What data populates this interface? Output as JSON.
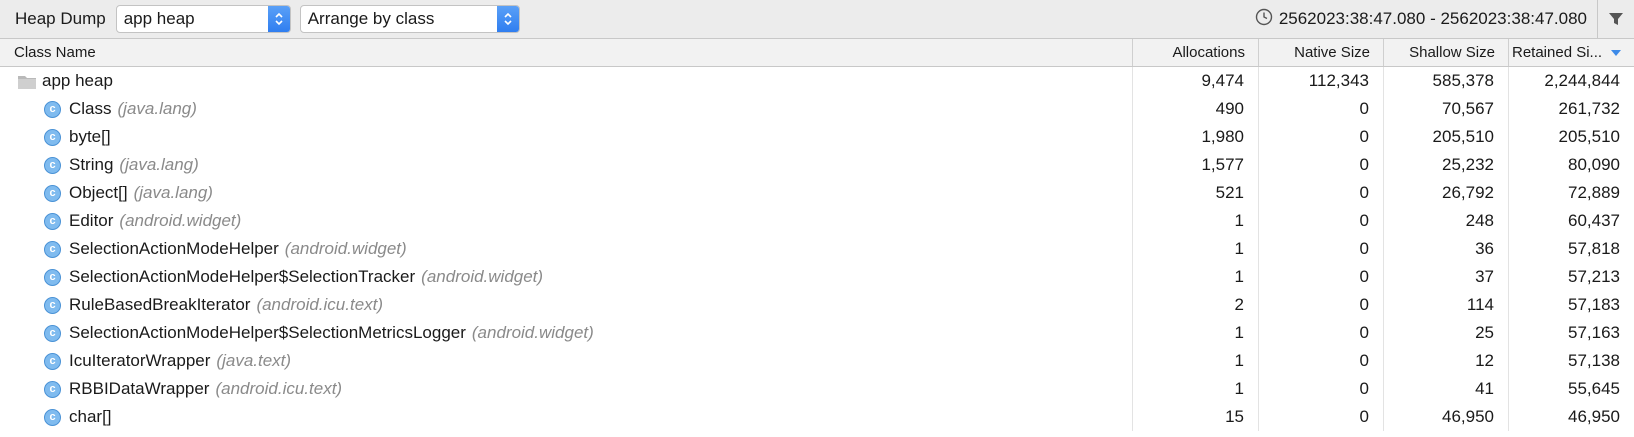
{
  "toolbar": {
    "title": "Heap Dump",
    "heap_select": "app heap",
    "arrange_select": "Arrange by class",
    "time_range": "2562023:38:47.080 - 2562023:38:47.080"
  },
  "table": {
    "columns": [
      "Class Name",
      "Allocations",
      "Native Size",
      "Shallow Size",
      "Retained Si..."
    ],
    "sorted_column": "Retained Si...",
    "root": {
      "name": "app heap",
      "allocations": "9,474",
      "native": "112,343",
      "shallow": "585,378",
      "retained": "2,244,844"
    },
    "rows": [
      {
        "name": "Class",
        "pkg": "(java.lang)",
        "allocations": "490",
        "native": "0",
        "shallow": "70,567",
        "retained": "261,732"
      },
      {
        "name": "byte[]",
        "pkg": "",
        "allocations": "1,980",
        "native": "0",
        "shallow": "205,510",
        "retained": "205,510"
      },
      {
        "name": "String",
        "pkg": "(java.lang)",
        "allocations": "1,577",
        "native": "0",
        "shallow": "25,232",
        "retained": "80,090"
      },
      {
        "name": "Object[]",
        "pkg": "(java.lang)",
        "allocations": "521",
        "native": "0",
        "shallow": "26,792",
        "retained": "72,889"
      },
      {
        "name": "Editor",
        "pkg": "(android.widget)",
        "allocations": "1",
        "native": "0",
        "shallow": "248",
        "retained": "60,437"
      },
      {
        "name": "SelectionActionModeHelper",
        "pkg": "(android.widget)",
        "allocations": "1",
        "native": "0",
        "shallow": "36",
        "retained": "57,818"
      },
      {
        "name": "SelectionActionModeHelper$SelectionTracker",
        "pkg": "(android.widget)",
        "allocations": "1",
        "native": "0",
        "shallow": "37",
        "retained": "57,213"
      },
      {
        "name": "RuleBasedBreakIterator",
        "pkg": "(android.icu.text)",
        "allocations": "2",
        "native": "0",
        "shallow": "114",
        "retained": "57,183"
      },
      {
        "name": "SelectionActionModeHelper$SelectionMetricsLogger",
        "pkg": "(android.widget)",
        "allocations": "1",
        "native": "0",
        "shallow": "25",
        "retained": "57,163"
      },
      {
        "name": "IcuIteratorWrapper",
        "pkg": "(java.text)",
        "allocations": "1",
        "native": "0",
        "shallow": "12",
        "retained": "57,138"
      },
      {
        "name": "RBBIDataWrapper",
        "pkg": "(android.icu.text)",
        "allocations": "1",
        "native": "0",
        "shallow": "41",
        "retained": "55,645"
      },
      {
        "name": "char[]",
        "pkg": "",
        "allocations": "15",
        "native": "0",
        "shallow": "46,950",
        "retained": "46,950"
      }
    ]
  },
  "colors": {
    "accent": "#2f7ef0",
    "class_icon": "#7fbbef",
    "package_text": "#8a8a8a"
  },
  "icons": [
    "chevron-updown-icon",
    "clock-icon",
    "filter-icon",
    "folder-icon",
    "class-icon",
    "sort-desc-icon"
  ]
}
